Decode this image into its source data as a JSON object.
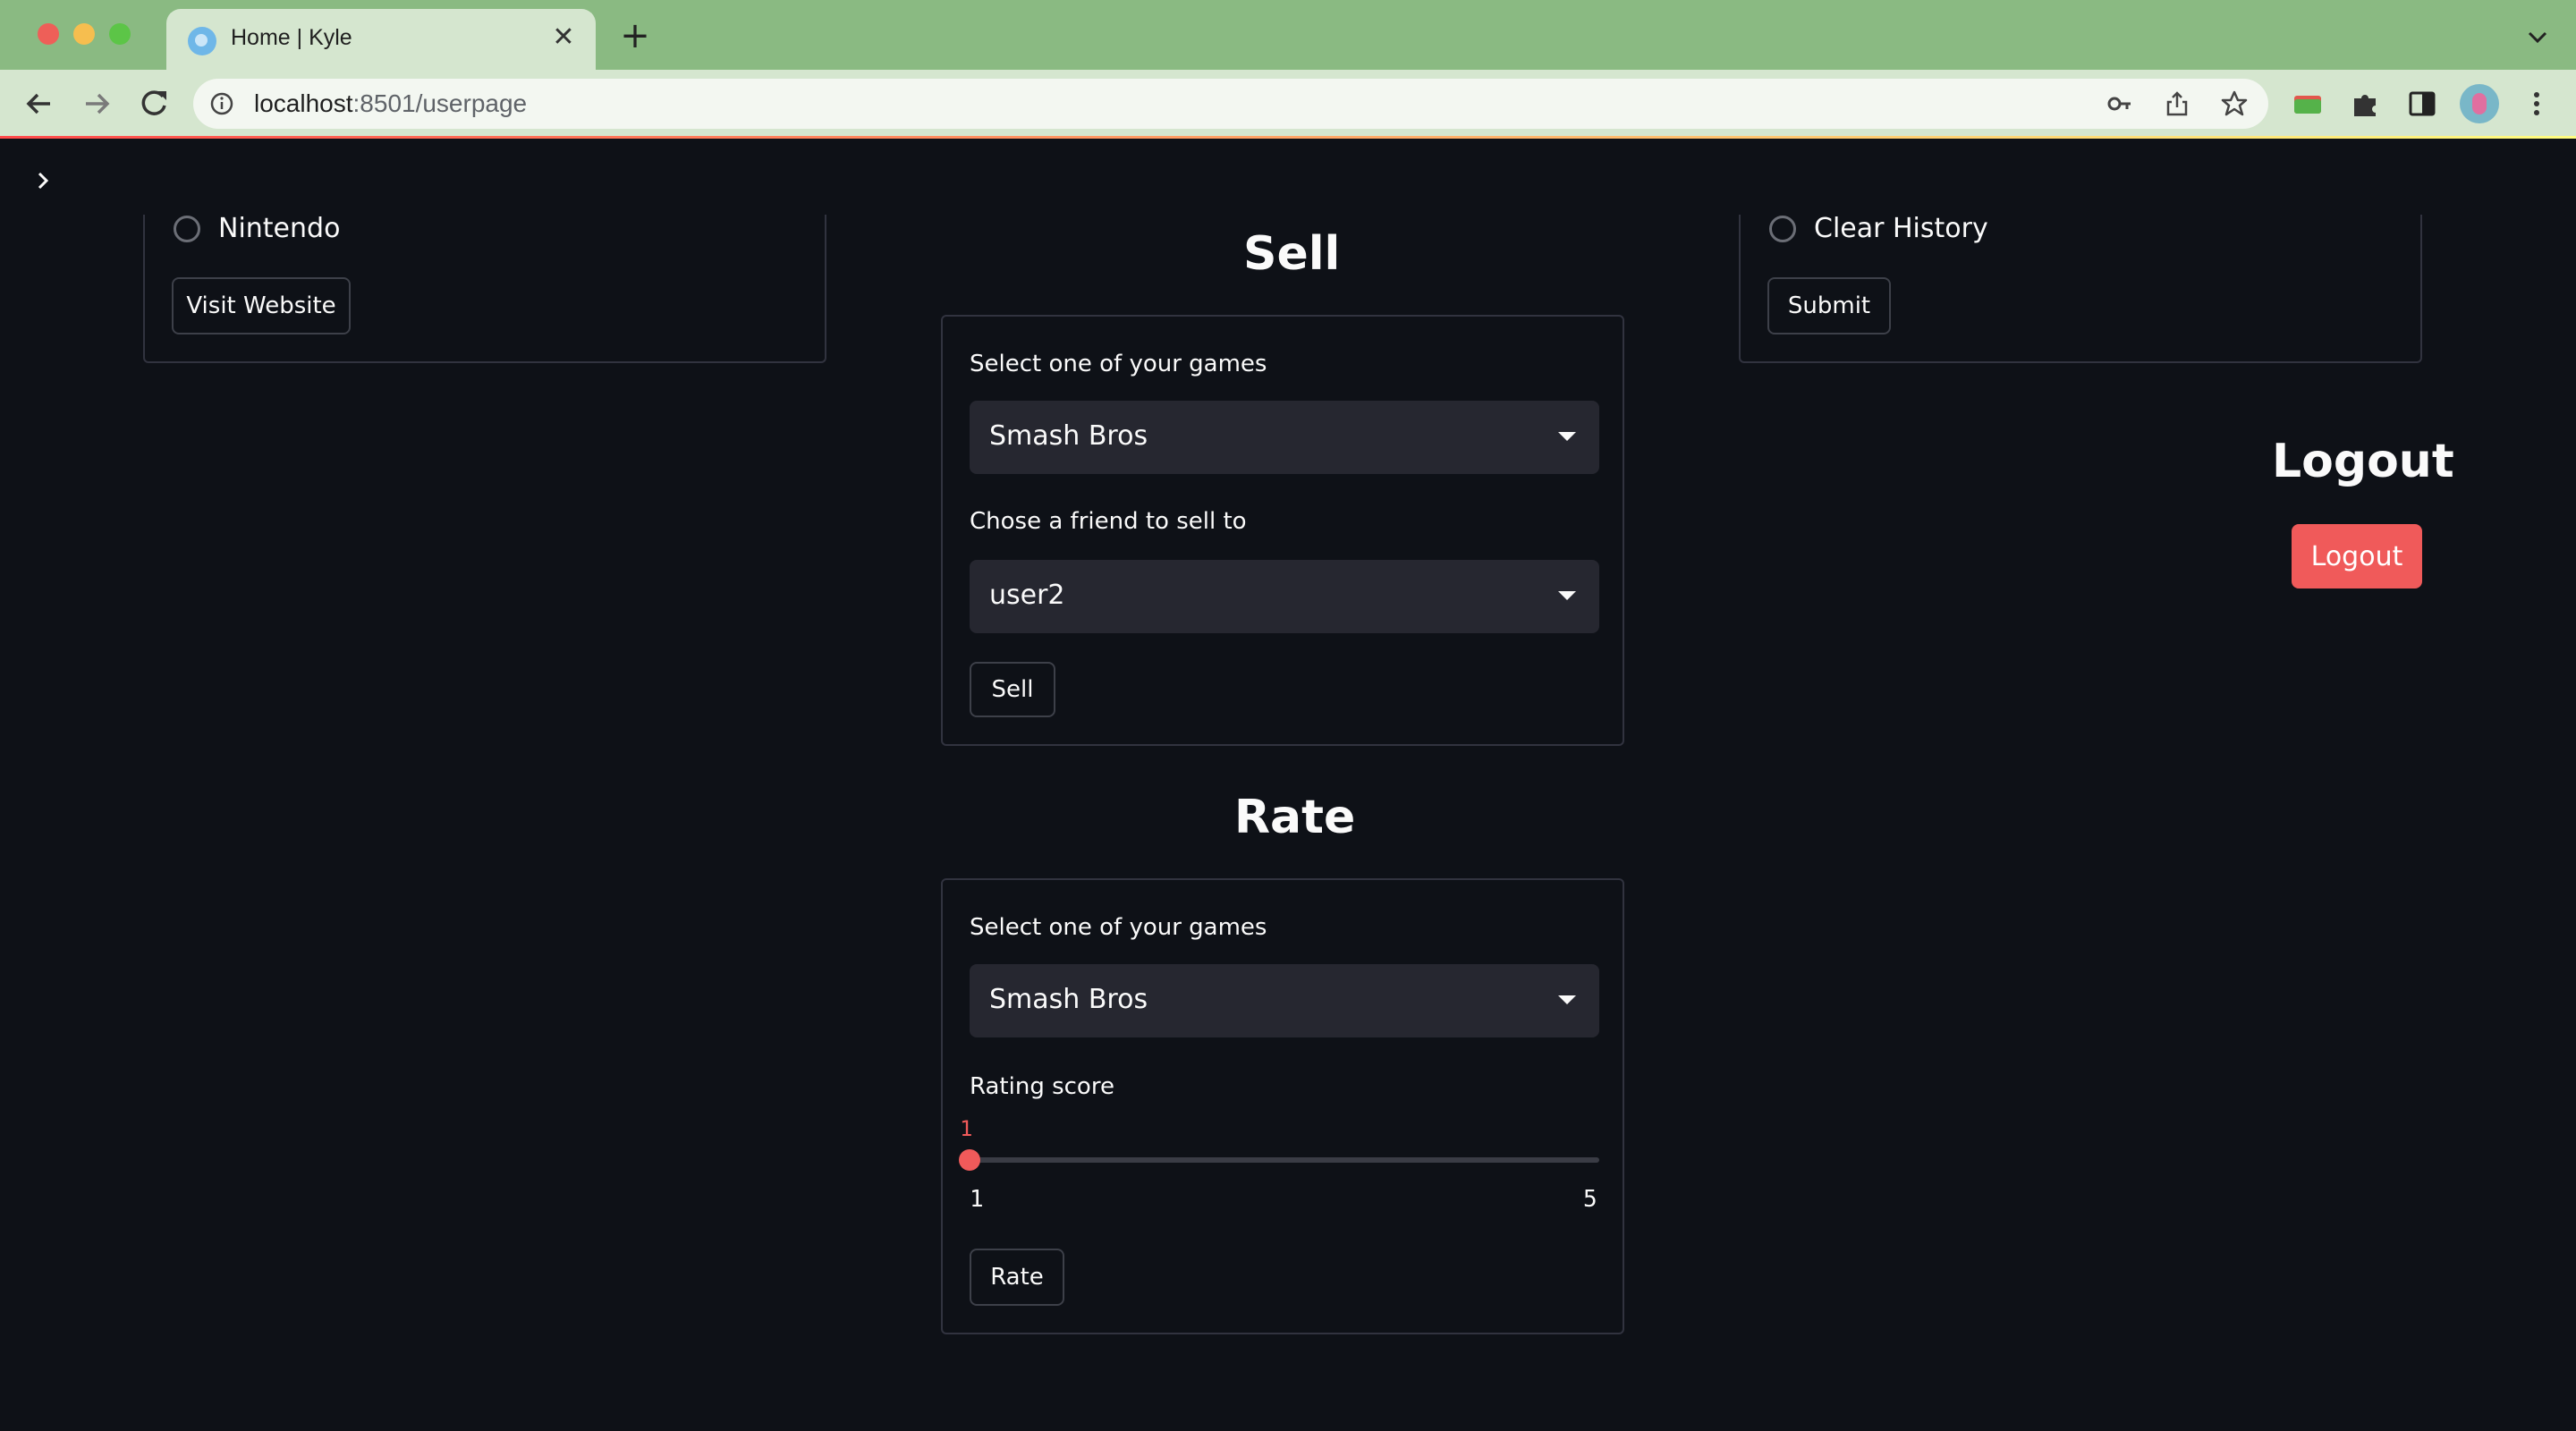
{
  "browser": {
    "tab_title": "Home | Kyle",
    "url_host": "localhost",
    "url_rest": ":8501/userpage"
  },
  "left_card": {
    "radio_label": "Nintendo",
    "button_label": "Visit Website"
  },
  "right_card": {
    "radio_label": "Clear History",
    "button_label": "Submit"
  },
  "sell": {
    "heading": "Sell",
    "game_label": "Select one of your games",
    "game_value": "Smash Bros",
    "friend_label": "Chose a friend to sell to",
    "friend_value": "user2",
    "button_label": "Sell"
  },
  "rate": {
    "heading": "Rate",
    "game_label": "Select one of your games",
    "game_value": "Smash Bros",
    "score_label": "Rating score",
    "score_value": "1",
    "score_min": "1",
    "score_max": "5",
    "button_label": "Rate"
  },
  "logout": {
    "heading": "Logout",
    "button_label": "Logout"
  },
  "colors": {
    "background": "#0e1117",
    "primary": "#f05a5a",
    "select_bg": "#262730",
    "chrome_tabbar": "#8aba82",
    "chrome_toolbar": "#d5e6cf"
  }
}
